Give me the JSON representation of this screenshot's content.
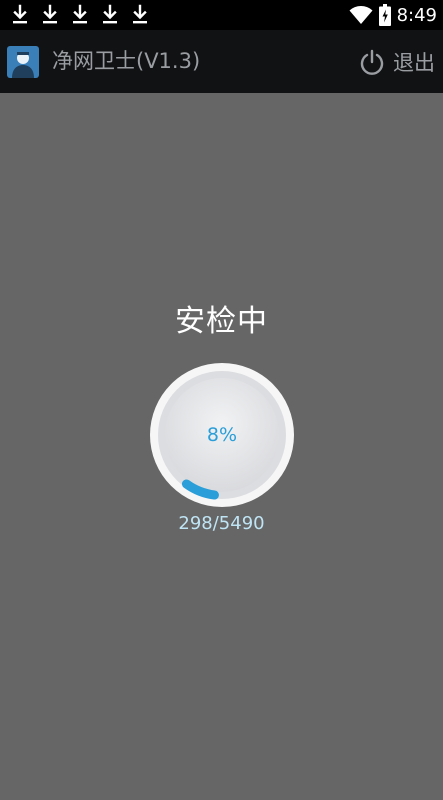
{
  "status_bar": {
    "notification_icons": [
      "download-icon",
      "download-icon",
      "download-icon",
      "download-icon",
      "download-icon"
    ],
    "time": "8:49",
    "icons": [
      "wifi-icon",
      "battery-icon"
    ]
  },
  "action_bar": {
    "app_icon": "app-logo-icon",
    "title": "净网卫士(V1.3)",
    "exit_icon": "power-icon",
    "exit_label": "退出"
  },
  "scan": {
    "status_text": "安检中",
    "progress_percent_label": "8%",
    "progress_fraction": 0.08,
    "progress_count": "298/5490"
  },
  "colors": {
    "background": "#666666",
    "accent": "#2a9ed8",
    "count_text": "#bfe4f4"
  }
}
